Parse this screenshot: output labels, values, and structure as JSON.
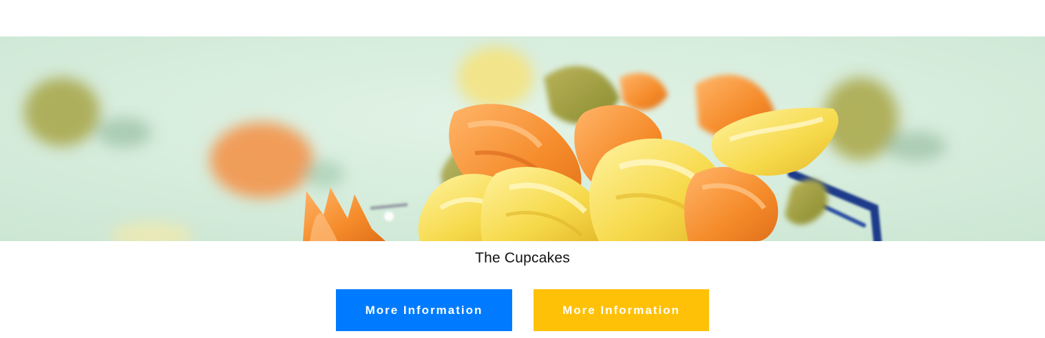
{
  "hero": {
    "image_subject": "pasta-photo",
    "background_color": "#d6eddd"
  },
  "caption": {
    "text": "The Cupcakes"
  },
  "buttons": {
    "primary": {
      "label": "More Information",
      "color": "#007bff"
    },
    "warning": {
      "label": "More Information",
      "color": "#ffc107"
    }
  }
}
